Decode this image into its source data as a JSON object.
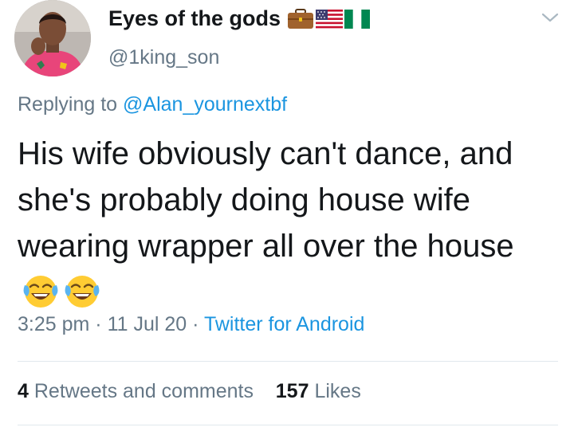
{
  "author": {
    "display_name": "Eyes of the gods",
    "handle": "@1king_son",
    "name_emojis": [
      "briefcase-emoji",
      "us-flag-emoji",
      "nigeria-flag-emoji"
    ]
  },
  "reply": {
    "prefix": "Replying to",
    "mention": "@Alan_yournextbf"
  },
  "tweet": {
    "text": "His wife obviously can't dance, and she's probably doing house wife wearing wrapper all over the house",
    "emojis": [
      "tears-of-joy-emoji",
      "tears-of-joy-emoji"
    ]
  },
  "meta": {
    "time": "3:25 pm",
    "separator": " · ",
    "date": "11 Jul 20",
    "source": "Twitter for Android"
  },
  "stats": {
    "retweets_count": "4",
    "retweets_label": "Retweets and comments",
    "likes_count": "157",
    "likes_label": "Likes"
  },
  "colors": {
    "text_primary": "#14171a",
    "text_secondary": "#657786",
    "link": "#1b95e0",
    "divider": "#e1e8ed"
  }
}
